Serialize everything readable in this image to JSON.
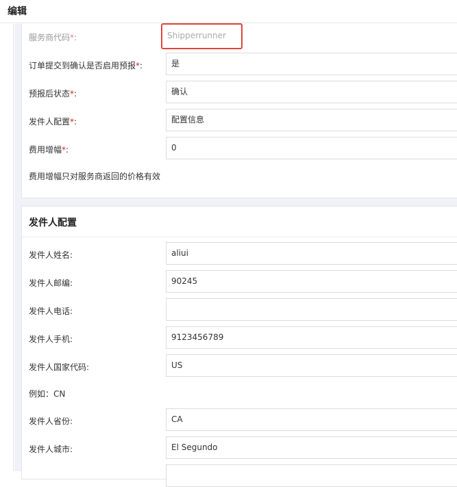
{
  "header": {
    "title": "编辑"
  },
  "settings": {
    "service_code": {
      "label": "服务商代码",
      "value": "Shipperrunner"
    },
    "auto_prealert": {
      "label": "订单提交到确认是否启用预报",
      "value": "是"
    },
    "post_prealert_status": {
      "label": "预报后状态",
      "value": "确认"
    },
    "sender_config": {
      "label": "发件人配置",
      "value": "配置信息"
    },
    "fee_increase": {
      "label": "费用增幅",
      "value": "0"
    },
    "fee_hint": "费用增幅只对服务商返回的价格有效",
    "colon": ":",
    "required_mark": "*"
  },
  "sender": {
    "title": "发件人配置",
    "name": {
      "label": "发件人姓名:",
      "value": "aliui"
    },
    "zip": {
      "label": "发件人邮编:",
      "value": "90245"
    },
    "phone": {
      "label": "发件人电话:",
      "value": ""
    },
    "mobile": {
      "label": "发件人手机:",
      "value": "9123456789"
    },
    "country": {
      "label": "发件人国家代码:",
      "value": "US"
    },
    "country_hint": "例如：CN",
    "province": {
      "label": "发件人省份:",
      "value": "CA"
    },
    "city": {
      "label": "发件人城市:",
      "value": "El Segundo"
    },
    "next": {
      "value": ""
    }
  },
  "colors": {
    "required": "#e02020",
    "highlight": "#e0443a",
    "background": "#f1f2f7"
  }
}
